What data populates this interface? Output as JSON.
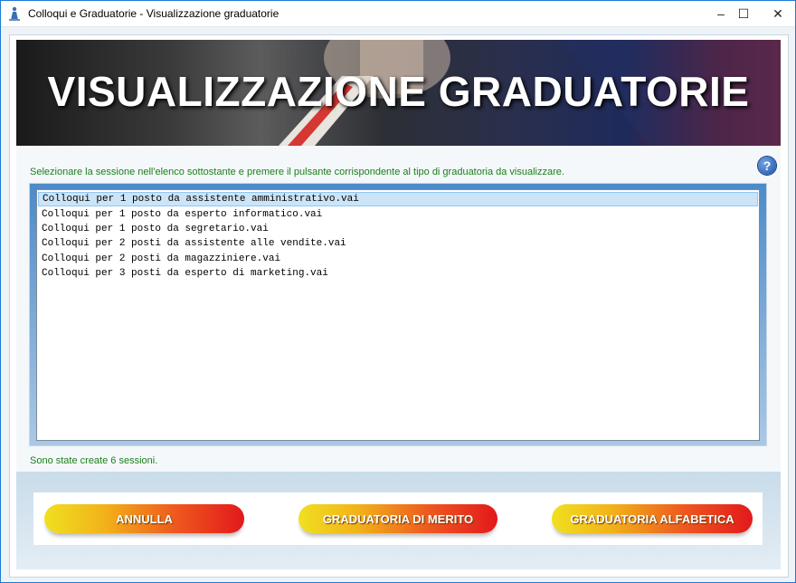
{
  "window": {
    "title": "Colloqui e Graduatorie - Visualizzazione graduatorie",
    "controls": {
      "minimize": "–",
      "maximize": "☐",
      "close": "✕"
    }
  },
  "banner": {
    "title": "VISUALIZZAZIONE GRADUATORIE"
  },
  "instruction": "Selezionare la sessione nell'elenco sottostante e premere il pulsante corrispondente al tipo di graduatoria da visualizzare.",
  "help": {
    "icon": "help-icon",
    "glyph": "?"
  },
  "sessions": {
    "selected_index": 0,
    "items": [
      "Colloqui per 1 posto da assistente amministrativo.vai",
      "Colloqui per 1 posto da esperto informatico.vai",
      "Colloqui per 1 posto da segretario.vai",
      "Colloqui per 2 posti da assistente alle vendite.vai",
      "Colloqui per 2 posti da magazziniere.vai",
      "Colloqui per 3 posti da esperto di marketing.vai"
    ]
  },
  "status": "Sono state create 6 sessioni.",
  "buttons": {
    "cancel": "ANNULLA",
    "merit": "GRADUATORIA DI MERITO",
    "alphabetical": "GRADUATORIA ALFABETICA"
  },
  "colors": {
    "accent_text": "#1a7f1a",
    "window_border": "#1c7bd6",
    "selection": "#cce4f7"
  }
}
